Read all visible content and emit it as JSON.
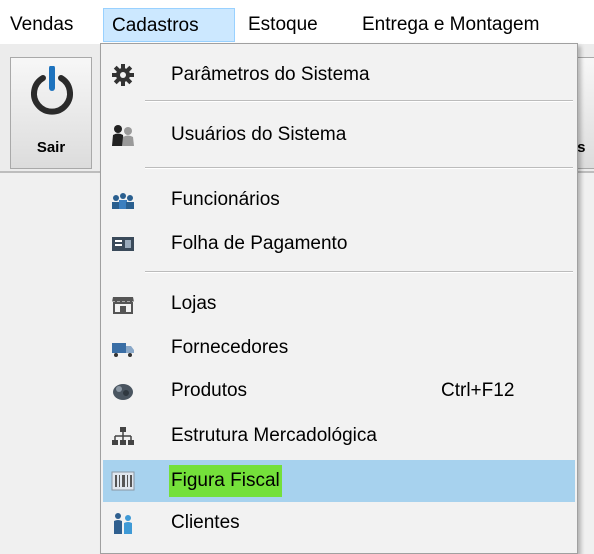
{
  "menubar": {
    "items": [
      "Vendas",
      "Cadastros",
      "Estoque",
      "Entrega e Montagem"
    ]
  },
  "toolbar": {
    "exit_label": "Sair",
    "partial_label": "res"
  },
  "dropdown": {
    "items": [
      {
        "label": "Parâmetros do Sistema",
        "icon": "gear-icon"
      },
      {
        "label": "Usuários do Sistema",
        "icon": "users-icon"
      },
      {
        "label": "Funcionários",
        "icon": "employees-icon"
      },
      {
        "label": "Folha de Pagamento",
        "icon": "payroll-icon"
      },
      {
        "label": "Lojas",
        "icon": "store-icon"
      },
      {
        "label": "Fornecedores",
        "icon": "truck-icon"
      },
      {
        "label": "Produtos",
        "icon": "products-icon",
        "shortcut": "Ctrl+F12"
      },
      {
        "label": "Estrutura Mercadológica",
        "icon": "hierarchy-icon"
      },
      {
        "label": "Figura Fiscal",
        "icon": "barcode-icon",
        "highlighted": true
      },
      {
        "label": "Clientes",
        "icon": "clients-icon"
      }
    ]
  },
  "colors": {
    "menu_selected_bg": "#cce8ff",
    "item_highlight_bg": "#a7d2ee",
    "text_highlight": "#74e03a",
    "power_icon": "#1e73be"
  }
}
